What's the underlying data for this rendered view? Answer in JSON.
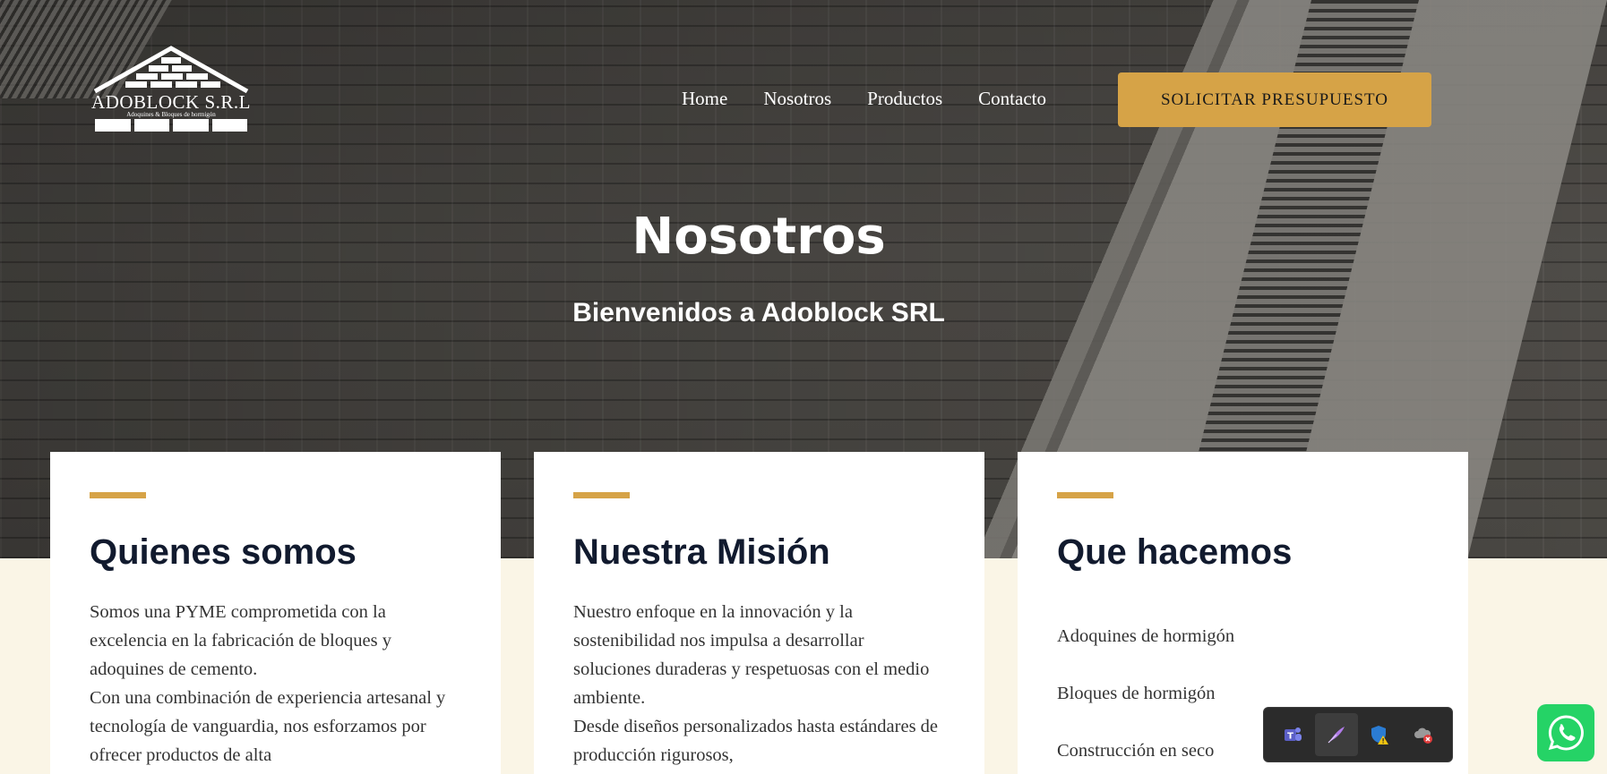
{
  "logo": {
    "name": "ADOBLOCK S.R.L",
    "tagline": "Adoquines & Bloques de hormigón"
  },
  "nav": {
    "items": [
      "Home",
      "Nosotros",
      "Productos",
      "Contacto"
    ],
    "cta_label": "SOLICITAR PRESUPUESTO"
  },
  "hero": {
    "title": "Nosotros",
    "subtitle": "Bienvenidos a Adoblock SRL"
  },
  "cards": [
    {
      "title": "Quienes somos",
      "paragraphs": [
        "Somos una PYME comprometida con la excelencia en la fabricación de bloques y adoquines de cemento.",
        "Con una combinación de experiencia artesanal y tecnología de vanguardia, nos esforzamos por ofrecer productos de alta"
      ]
    },
    {
      "title": "Nuestra Misión",
      "paragraphs": [
        "Nuestro enfoque en la innovación y la sostenibilidad nos impulsa a desarrollar soluciones duraderas y respetuosas con el medio ambiente.",
        "Desde diseños personalizados hasta estándares de producción rigurosos,"
      ]
    },
    {
      "title": "Que hacemos",
      "items": [
        "Adoquines de hormigón",
        "Bloques de hormigón",
        "Construcción en seco"
      ]
    }
  ],
  "tray": {
    "icons": [
      "teams-icon",
      "feather-icon",
      "defender-warning-icon",
      "cloud-error-icon"
    ]
  },
  "colors": {
    "accent": "#d6a347",
    "heading": "#111a2e",
    "page_bg": "#faf5e6",
    "whatsapp": "#25d366"
  }
}
